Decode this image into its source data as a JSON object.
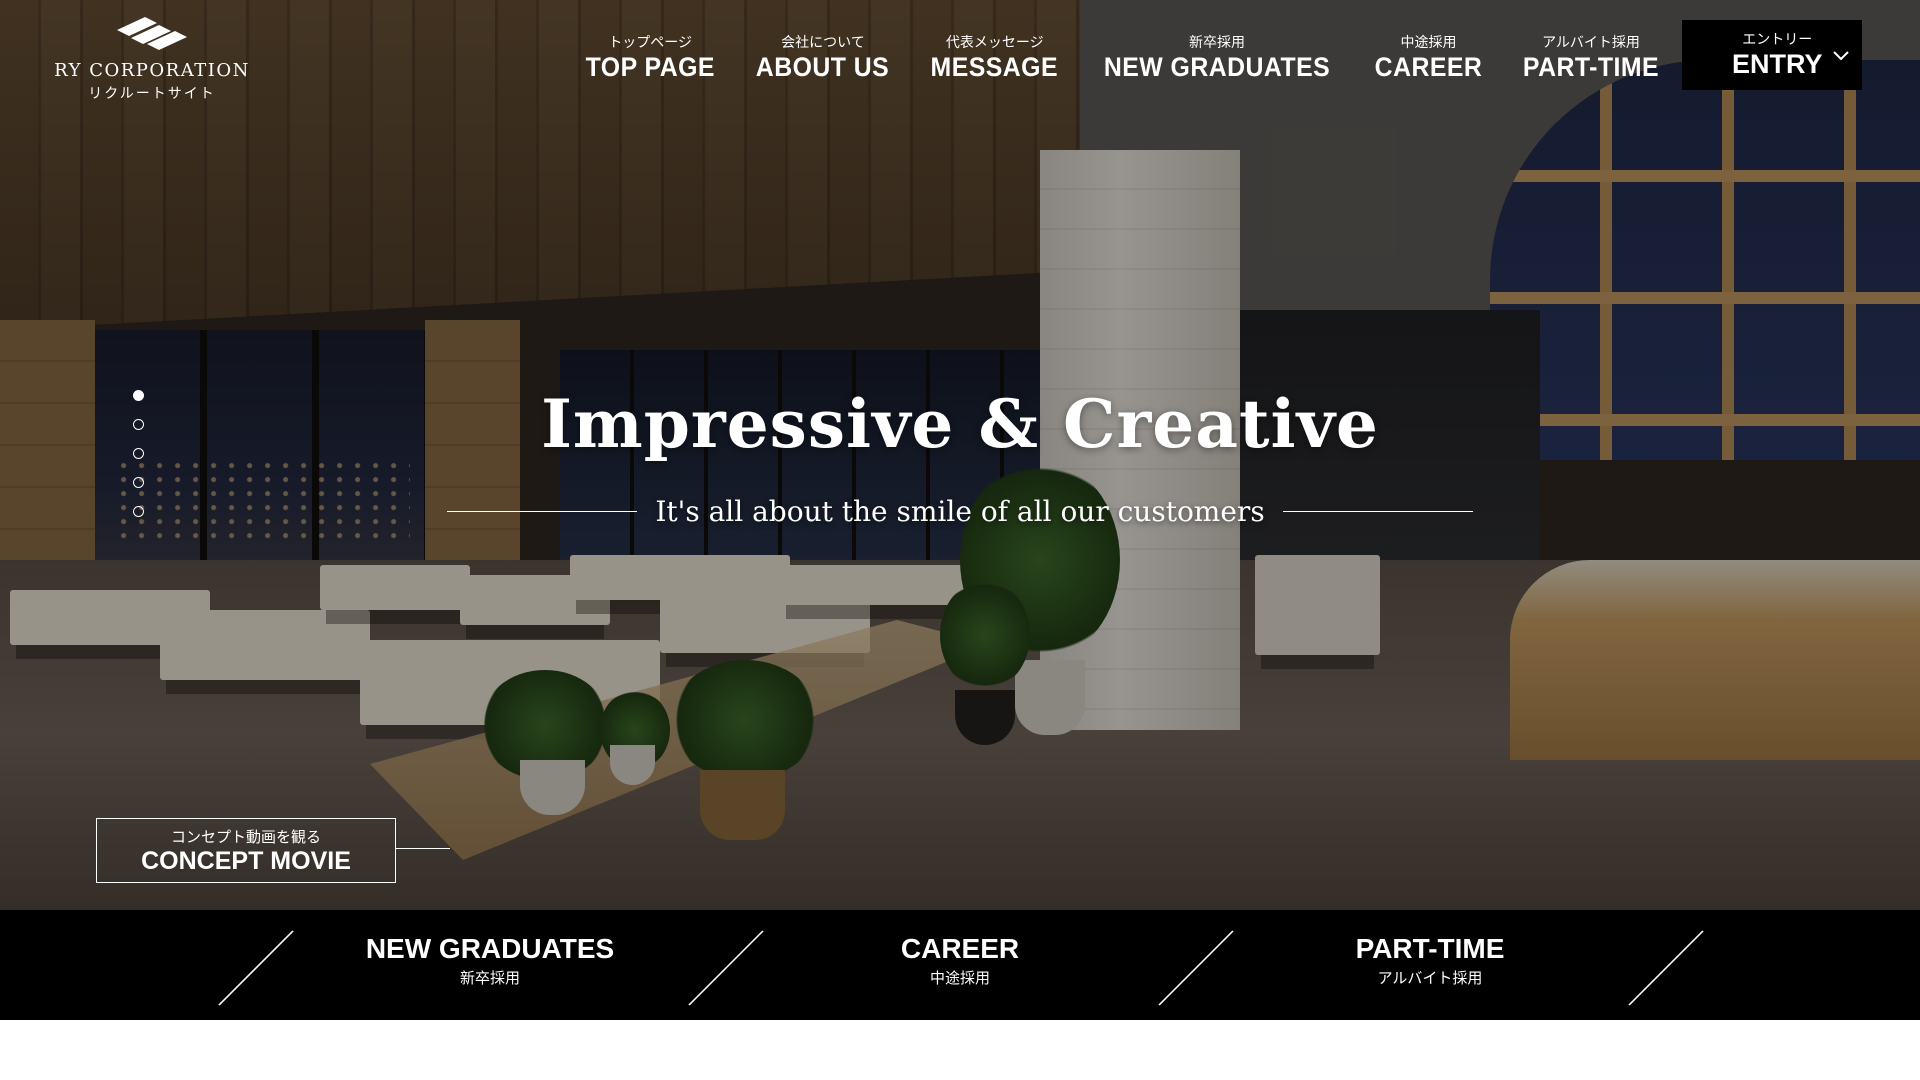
{
  "brand": {
    "name": "RY CORPORATION",
    "subtitle": "リクルートサイト"
  },
  "nav": [
    {
      "jp": "トップページ",
      "en": "TOP PAGE"
    },
    {
      "jp": "会社について",
      "en": "ABOUT US"
    },
    {
      "jp": "代表メッセージ",
      "en": "MESSAGE"
    },
    {
      "jp": "新卒採用",
      "en": "NEW GRADUATES"
    },
    {
      "jp": "中途採用",
      "en": "CAREER"
    },
    {
      "jp": "アルバイト採用",
      "en": "PART-TIME"
    }
  ],
  "entry": {
    "jp": "エントリー",
    "en": "ENTRY"
  },
  "hero": {
    "title": "Impressive & Creative",
    "subtitle": "It's all about the smile of all our customers",
    "slides": 5,
    "active_slide": 1
  },
  "concept_movie": {
    "jp": "コンセプト動画を観る",
    "en": "CONCEPT MOVIE"
  },
  "bottom_links": [
    {
      "en": "NEW GRADUATES",
      "jp": "新卒採用"
    },
    {
      "en": "CAREER",
      "jp": "中途採用"
    },
    {
      "en": "PART-TIME",
      "jp": "アルバイト採用"
    }
  ],
  "colors": {
    "bar": "#000000",
    "text": "#ffffff"
  }
}
